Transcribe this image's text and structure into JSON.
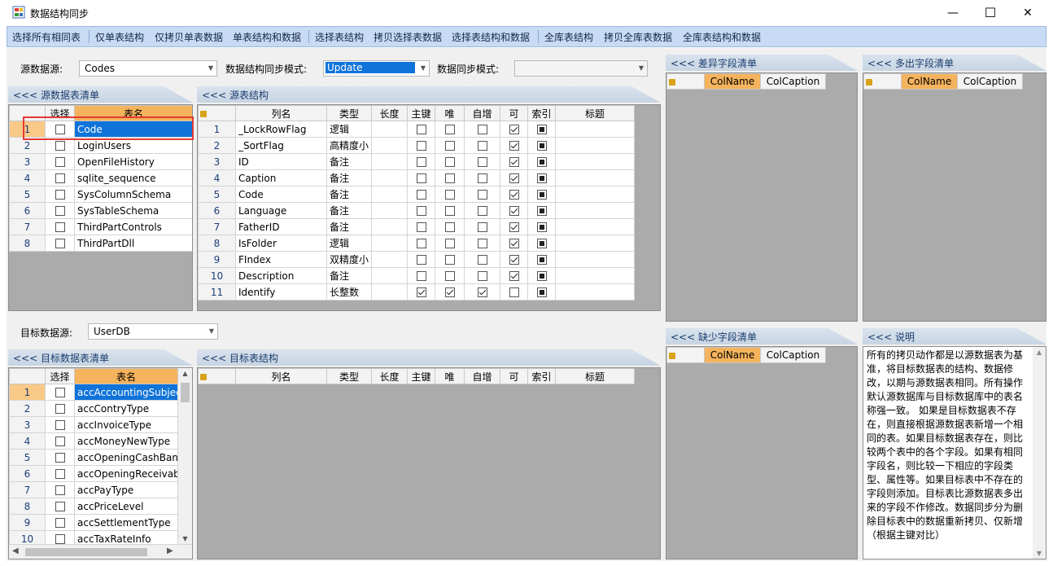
{
  "window": {
    "title": "数据结构同步",
    "minimize_glyph": "—",
    "maximize_glyph": "☐",
    "close_glyph": "✕"
  },
  "toolbar": [
    "选择所有相同表",
    "仅单表结构",
    "仅拷贝单表数据",
    "单表结构和数据",
    "选择表结构",
    "拷贝选择表数据",
    "选择表结构和数据",
    "全库表结构",
    "拷贝全库表数据",
    "全库表结构和数据"
  ],
  "source": {
    "ds_label": "源数据源:",
    "ds_value": "Codes",
    "mode_label": "数据结构同步模式:",
    "mode_value": "Update",
    "sync_label": "数据同步模式:",
    "sync_value": ""
  },
  "target": {
    "ds_label": "目标数据源:",
    "ds_value": "UserDB"
  },
  "panels": {
    "src_tables": "<<< 源数据表清单",
    "src_struct": "<<< 源表结构",
    "diff": "<<< 差异字段清单",
    "extra": "<<< 多出字段清单",
    "missing": "<<< 缺少字段清单",
    "desc": "<<< 说明",
    "tgt_tables": "<<< 目标数据表清单",
    "tgt_struct": "<<< 目标表结构"
  },
  "table_list_headers": {
    "select": "选择",
    "name": "表名"
  },
  "src_tables": [
    {
      "n": "1",
      "name": "Code"
    },
    {
      "n": "2",
      "name": "LoginUsers"
    },
    {
      "n": "3",
      "name": "OpenFileHistory"
    },
    {
      "n": "4",
      "name": "sqlite_sequence"
    },
    {
      "n": "5",
      "name": "SysColumnSchema"
    },
    {
      "n": "6",
      "name": "SysTableSchema"
    },
    {
      "n": "7",
      "name": "ThirdPartControls"
    },
    {
      "n": "8",
      "name": "ThirdPartDll"
    }
  ],
  "struct_headers": {
    "col": "列名",
    "type": "类型",
    "len": "长度",
    "pk": "主键",
    "uniq": "唯",
    "auto": "自增",
    "nullable": "可",
    "index": "索引",
    "title": "标题"
  },
  "src_struct": [
    {
      "n": "1",
      "col": "_LockRowFlag",
      "type": "逻辑",
      "pk": false,
      "uniq": false,
      "auto": false,
      "nullable": true
    },
    {
      "n": "2",
      "col": "_SortFlag",
      "type": "高精度小",
      "pk": false,
      "uniq": false,
      "auto": false,
      "nullable": true
    },
    {
      "n": "3",
      "col": "ID",
      "type": "备注",
      "pk": false,
      "uniq": false,
      "auto": false,
      "nullable": true
    },
    {
      "n": "4",
      "col": "Caption",
      "type": "备注",
      "pk": false,
      "uniq": false,
      "auto": false,
      "nullable": true
    },
    {
      "n": "5",
      "col": "Code",
      "type": "备注",
      "pk": false,
      "uniq": false,
      "auto": false,
      "nullable": true
    },
    {
      "n": "6",
      "col": "Language",
      "type": "备注",
      "pk": false,
      "uniq": false,
      "auto": false,
      "nullable": true
    },
    {
      "n": "7",
      "col": "FatherID",
      "type": "备注",
      "pk": false,
      "uniq": false,
      "auto": false,
      "nullable": true
    },
    {
      "n": "8",
      "col": "IsFolder",
      "type": "逻辑",
      "pk": false,
      "uniq": false,
      "auto": false,
      "nullable": true
    },
    {
      "n": "9",
      "col": "FIndex",
      "type": "双精度小",
      "pk": false,
      "uniq": false,
      "auto": false,
      "nullable": true
    },
    {
      "n": "10",
      "col": "Description",
      "type": "备注",
      "pk": false,
      "uniq": false,
      "auto": false,
      "nullable": true
    },
    {
      "n": "11",
      "col": "Identify",
      "type": "长整数",
      "pk": true,
      "uniq": true,
      "auto": true,
      "nullable": false
    }
  ],
  "field_headers": {
    "name": "ColName",
    "caption": "ColCaption"
  },
  "tgt_tables": [
    {
      "n": "1",
      "name": "accAccountingSubjec"
    },
    {
      "n": "2",
      "name": "accContryType"
    },
    {
      "n": "3",
      "name": "accInvoiceType"
    },
    {
      "n": "4",
      "name": "accMoneyNewType"
    },
    {
      "n": "5",
      "name": "accOpeningCashBanl"
    },
    {
      "n": "6",
      "name": "accOpeningReceivab"
    },
    {
      "n": "7",
      "name": "accPayType"
    },
    {
      "n": "8",
      "name": "accPriceLevel"
    },
    {
      "n": "9",
      "name": "accSettlementType"
    },
    {
      "n": "10",
      "name": "accTaxRateInfo"
    }
  ],
  "description": "所有的拷贝动作都是以源数据表为基准，将目标数据表的结构、数据修改，以期与源数据表相同。所有操作默认源数据库与目标数据库中的表名称强一致。 如果是目标数据表不存在，则直接根据源数据表新增一个相同的表。如果目标数据表存在，则比较两个表中的各个字段。如果有相同字段名，则比较一下相应的字段类型、属性等。如果目标表中不存在的字段则添加。目标表比源数据表多出来的字段不作修改。数据同步分为删除目标表中的数据重新拷贝、仅新增（根据主键对比）"
}
